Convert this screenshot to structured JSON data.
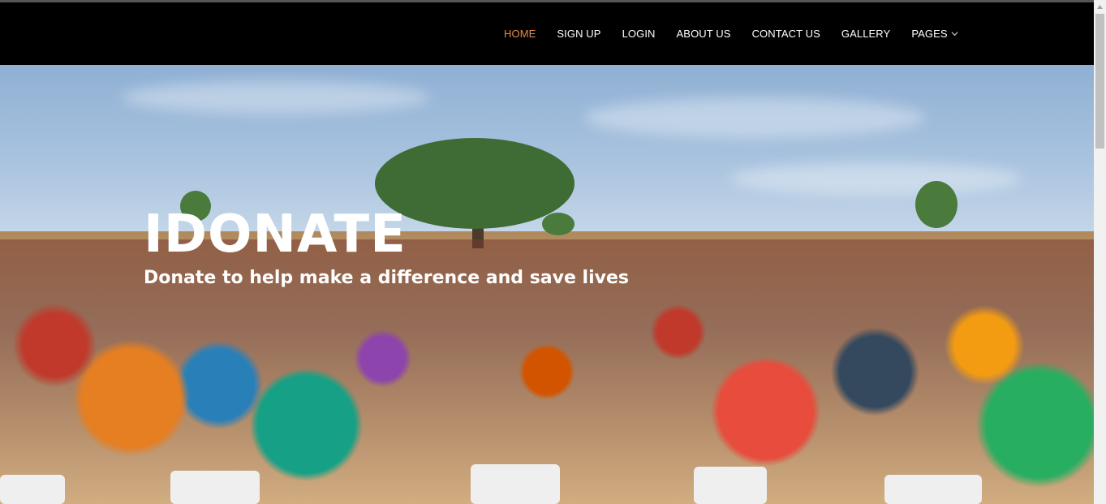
{
  "nav": {
    "items": [
      {
        "label": "HOME",
        "active": true
      },
      {
        "label": "SIGN UP",
        "active": false
      },
      {
        "label": "LOGIN",
        "active": false
      },
      {
        "label": "ABOUT US",
        "active": false
      },
      {
        "label": "CONTACT US",
        "active": false
      },
      {
        "label": "GALLERY",
        "active": false
      },
      {
        "label": "PAGES",
        "active": false,
        "has_dropdown": true,
        "dropdown_icon": "chevron-down-icon"
      }
    ],
    "active_color": "#e88a4a",
    "background_color": "#000000"
  },
  "hero": {
    "title": "IDONATE",
    "subtitle": "Donate to help make a difference and save lives"
  }
}
